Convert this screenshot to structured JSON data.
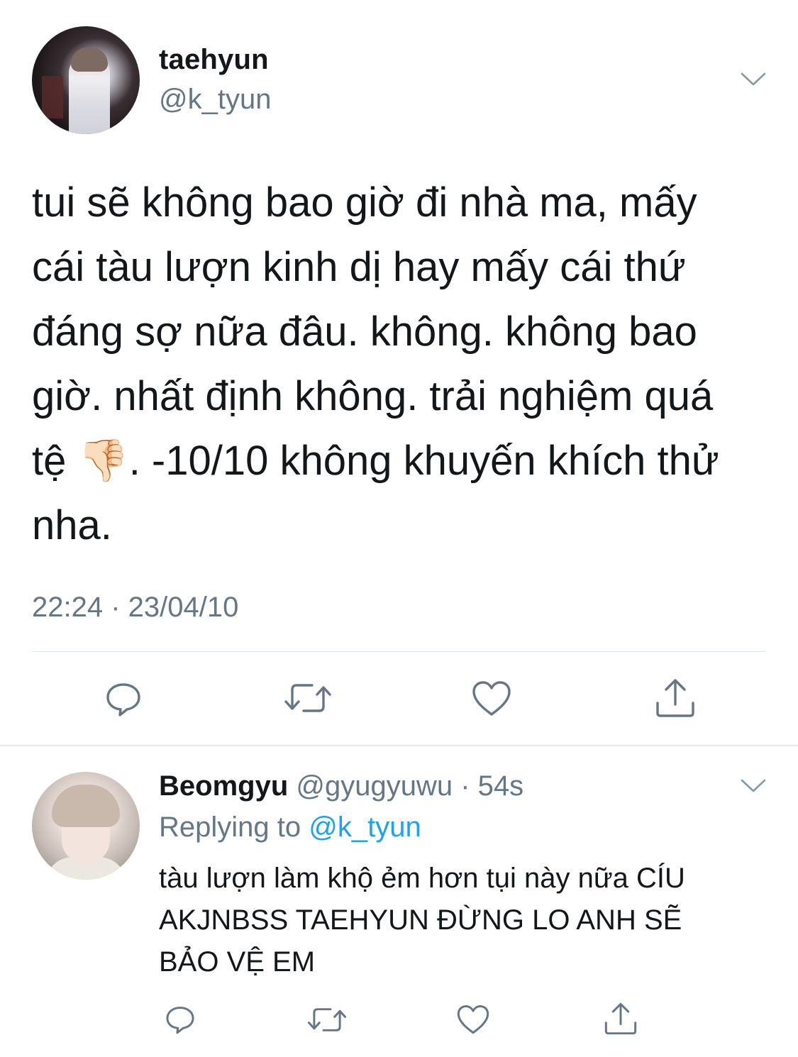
{
  "main_tweet": {
    "display_name": "taehyun",
    "handle": "@k_tyun",
    "text_lines": [
      "tui sẽ không bao giờ đi nhà ma, mấy",
      "cái tàu lượn kinh dị hay mấy cái thứ",
      "đáng sợ nữa đâu. không. không bao",
      "giờ. nhất định không. trải nghiệm quá",
      "tệ 👎🏻. -10/10 không khuyến khích thử",
      "nha."
    ],
    "timestamp": "22:24 · 23/04/10",
    "actions": [
      "reply-icon",
      "retweet-icon",
      "like-icon",
      "share-icon"
    ]
  },
  "reply_tweet": {
    "display_name": "Beomgyu",
    "handle": "@gyugyuwu",
    "separator": " · ",
    "time": "54s",
    "replying_prefix": "Replying to ",
    "replying_handle": "@k_tyun",
    "text_lines": [
      "tàu lượn làm khộ ẻm hơn tụi này nữa CÍU",
      "AKJNBSS TAEHYUN ĐỪNG LO ANH SẼ",
      "BẢO VỆ EM"
    ],
    "actions": [
      "reply-icon",
      "retweet-icon",
      "like-icon",
      "share-icon"
    ]
  },
  "colors": {
    "text_primary": "#14171a",
    "text_secondary": "#657786",
    "link": "#1da1f2",
    "divider": "#e1e8ed",
    "icon": "#657786"
  }
}
